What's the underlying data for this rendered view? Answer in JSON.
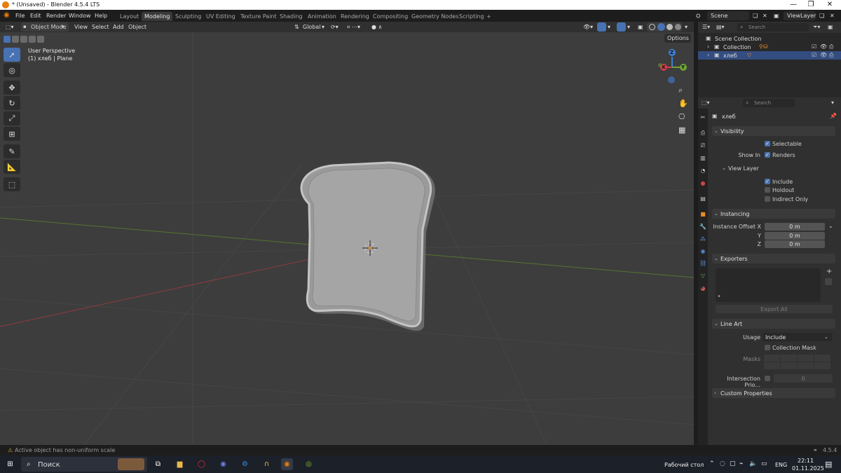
{
  "window": {
    "title": "* (Unsaved) - Blender 4.5.4 LTS",
    "min": "—",
    "max": "❐",
    "close": "✕"
  },
  "menu": [
    "File",
    "Edit",
    "Render",
    "Window",
    "Help"
  ],
  "workspaces": [
    "Layout",
    "Modeling",
    "Sculpting",
    "UV Editing",
    "Texture Paint",
    "Shading",
    "Animation",
    "Rendering",
    "Compositing",
    "Geometry Nodes",
    "Scripting",
    "+"
  ],
  "active_workspace": "Modeling",
  "scene": {
    "label": "Scene",
    "view_layer": "ViewLayer"
  },
  "viewport_header": {
    "mode": "Object Mode",
    "view": "View",
    "select": "Select",
    "add": "Add",
    "object": "Object",
    "transform_orientation": "Global",
    "options": "Options"
  },
  "viewport": {
    "perspective": "User Perspective",
    "object_info": "(1) хлеб | Plane",
    "axes": {
      "x": "X",
      "y": "Y",
      "z": "Z"
    },
    "colors": {
      "x_axis": "#d33a4a",
      "y_axis": "#6ea536",
      "z_axis": "#3d7fd6",
      "bg": "#3d3d3d"
    }
  },
  "outliner": {
    "search_placeholder": "Search",
    "rows": [
      {
        "label": "Scene Collection"
      },
      {
        "label": "Collection"
      },
      {
        "label": "хлеб"
      }
    ]
  },
  "properties": {
    "search_placeholder": "Search",
    "object_name": "хлеб",
    "visibility": {
      "title": "Visibility",
      "selectable": "Selectable",
      "show_in": "Show In",
      "renders": "Renders",
      "view_layer": "View Layer",
      "include": "Include",
      "holdout": "Holdout",
      "indirect_only": "Indirect Only"
    },
    "instancing": {
      "title": "Instancing",
      "offset_x_label": "Instance Offset X",
      "y_label": "Y",
      "z_label": "Z",
      "x": "0 m",
      "y": "0 m",
      "z": "0 m"
    },
    "exporters": {
      "title": "Exporters",
      "export_all": "Export All",
      "add": "+"
    },
    "line_art": {
      "title": "Line Art",
      "usage_label": "Usage",
      "usage": "Include",
      "collection_mask": "Collection Mask",
      "masks": "Masks",
      "intersection_priority": "Intersection Prio...",
      "intersection_value": "0"
    },
    "custom_properties": {
      "title": "Custom Properties"
    }
  },
  "status": {
    "message": "Active object has non-uniform scale",
    "version": "4.5.4"
  },
  "taskbar": {
    "search": "Поиск",
    "desktop": "Рабочий стол",
    "lang": "ENG",
    "time": "22:11",
    "date": "01.11.2025"
  }
}
